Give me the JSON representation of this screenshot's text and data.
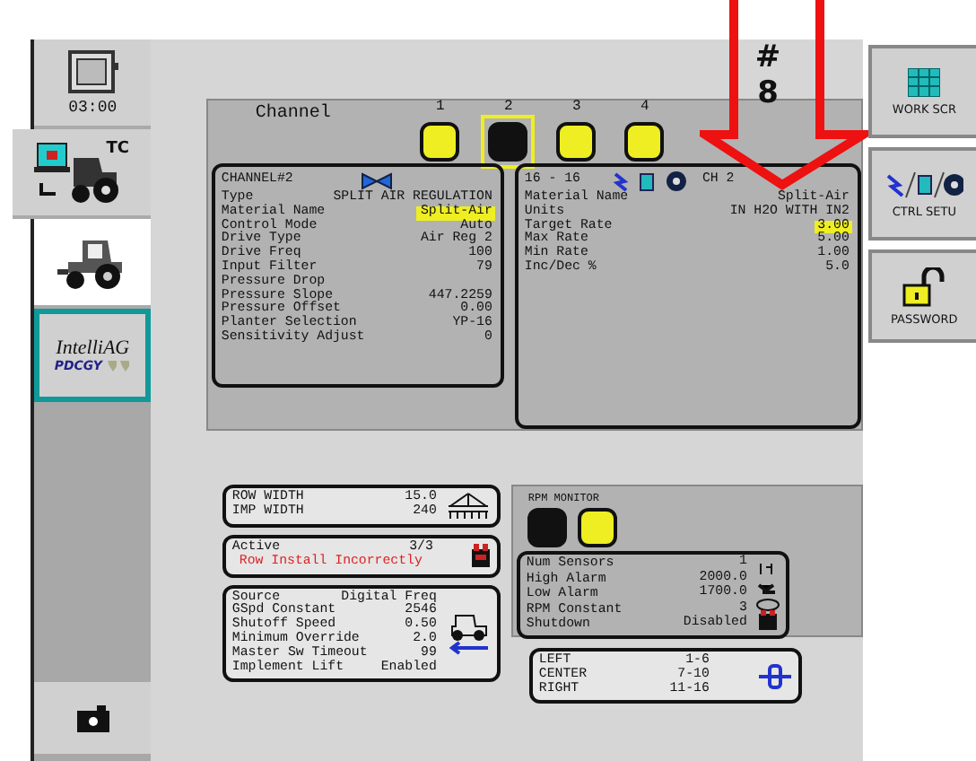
{
  "sidebar": {
    "items": [
      {
        "kind": "clock",
        "label": "03:00",
        "selected": false,
        "focused": false
      },
      {
        "kind": "tc",
        "label": "TC",
        "selected": false,
        "focused": false
      },
      {
        "kind": "tractor",
        "selected": true,
        "focused": false
      },
      {
        "kind": "brand",
        "label": "IntelliAG",
        "sublabel": "PDCGY",
        "selected": false,
        "focused": true
      }
    ],
    "bottom_button": {
      "kind": "camera"
    }
  },
  "channel_bar": {
    "label": "Channel",
    "channels": [
      {
        "label": "1",
        "selected": false
      },
      {
        "label": "2",
        "selected": true
      },
      {
        "label": "3",
        "selected": false
      },
      {
        "label": "4",
        "selected": false
      }
    ]
  },
  "channel_card": {
    "title": "CHANNEL#2",
    "rows": [
      {
        "label": "Type",
        "value": "SPLIT AIR REGULATION",
        "highlighted": false
      },
      {
        "label": "Material Name",
        "value": "Split-Air",
        "highlighted": true
      },
      {
        "label": "Control Mode",
        "value": "Auto",
        "highlighted": false
      },
      {
        "label": "Drive Type",
        "value": "Air Reg 2",
        "highlighted": false
      },
      {
        "label": "Drive Freq",
        "value": "100",
        "highlighted": false
      },
      {
        "label": "Input Filter",
        "value": "79",
        "highlighted": false
      },
      {
        "label": "Pressure Drop",
        "highlighted": false
      },
      {
        "label": "Pressure Slope",
        "value": "447.2259",
        "highlighted": false
      },
      {
        "label": "Pressure Offset",
        "value": "0.00",
        "highlighted": false
      },
      {
        "label": "Planter Selection",
        "value": "YP-16",
        "highlighted": false
      },
      {
        "label": "Sensitivity Adjust",
        "value": "0",
        "highlighted": false
      }
    ]
  },
  "rate_card": {
    "range": "16 - 16",
    "channel": "CH 2",
    "rows": [
      {
        "label": "Material Name",
        "value": "Split-Air",
        "highlighted": false
      },
      {
        "label": "Units",
        "value": "IN H2O WITH IN2",
        "highlighted": false
      },
      {
        "label": "Target Rate",
        "value": "3.00",
        "highlighted": true
      },
      {
        "label": "Max Rate",
        "value": "5.00",
        "highlighted": false
      },
      {
        "label": "Min Rate",
        "value": "1.00",
        "highlighted": false
      },
      {
        "label": "Inc/Dec %",
        "value": "5.0",
        "highlighted": false
      }
    ]
  },
  "width_card": {
    "rows": [
      {
        "label": "ROW WIDTH",
        "value": "15.0"
      },
      {
        "label": "IMP WIDTH",
        "value": "240"
      }
    ]
  },
  "alert_card": {
    "label": "Active",
    "count": "3/3",
    "message": "Row Install Incorrectly"
  },
  "speed_card": {
    "rows": [
      {
        "label": "Source",
        "value": "Digital Freq"
      },
      {
        "label": "GSpd Constant",
        "value": "2546"
      },
      {
        "label": "Shutoff Speed",
        "value": "0.50"
      },
      {
        "label": "Minimum Override",
        "value": "2.0"
      },
      {
        "label": "Master Sw Timeout",
        "value": "99"
      },
      {
        "label": "Implement Lift",
        "value": "Enabled"
      }
    ]
  },
  "rpm_monitor": {
    "title": "RPM MONITOR",
    "indicators": [
      {
        "on": false
      },
      {
        "on": true
      }
    ],
    "rows": [
      {
        "label": "Num Sensors",
        "value": "1"
      },
      {
        "label": "High Alarm",
        "value": "2000.0"
      },
      {
        "label": "Low Alarm",
        "value": "1700.0"
      },
      {
        "label": "RPM Constant",
        "value": "3"
      },
      {
        "label": "Shutdown",
        "value": "Disabled"
      }
    ]
  },
  "sections_card": {
    "rows": [
      {
        "label": "LEFT",
        "value": "1-6"
      },
      {
        "label": "CENTER",
        "value": "7-10"
      },
      {
        "label": "RIGHT",
        "value": "11-16"
      }
    ]
  },
  "right_buttons": [
    {
      "kind": "work",
      "label": "WORK SCR"
    },
    {
      "kind": "ctrl",
      "label": "CTRL SETU"
    },
    {
      "kind": "password",
      "label": "PASSWORD"
    }
  ],
  "annotation": {
    "mark": "#",
    "number": "8"
  }
}
